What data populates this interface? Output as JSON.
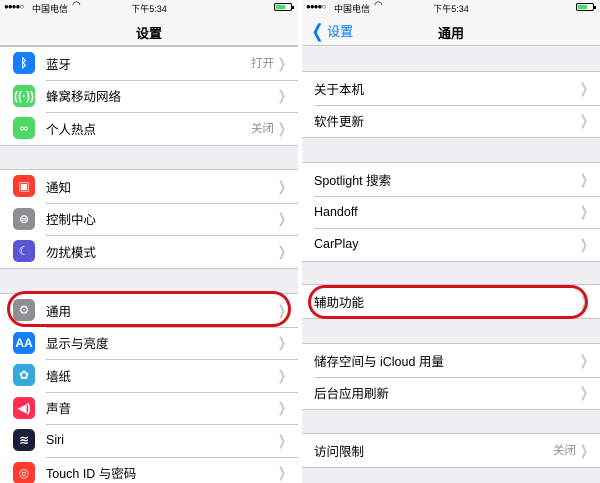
{
  "status_bar": {
    "signal": "●●●●○",
    "carrier": "中国电信",
    "time": "下午5:34"
  },
  "left": {
    "nav_title": "设置",
    "groups": [
      [
        {
          "label": "蓝牙",
          "value": "打开",
          "icon": "bluetooth-icon",
          "icon_glyph": "ᛒ",
          "color": "#147efb"
        },
        {
          "label": "蜂窝移动网络",
          "value": "",
          "icon": "cellular-icon",
          "icon_glyph": "((·))",
          "color": "#4cd964"
        },
        {
          "label": "个人热点",
          "value": "关闭",
          "icon": "hotspot-icon",
          "icon_glyph": "∞",
          "color": "#4cd964"
        }
      ],
      [
        {
          "label": "通知",
          "value": "",
          "icon": "notifications-icon",
          "icon_glyph": "▣",
          "color": "#ff3b30"
        },
        {
          "label": "控制中心",
          "value": "",
          "icon": "control-center-icon",
          "icon_glyph": "⊜",
          "color": "#8e8e93"
        },
        {
          "label": "勿扰模式",
          "value": "",
          "icon": "moon-icon",
          "icon_glyph": "☾",
          "color": "#5856d6"
        }
      ],
      [
        {
          "label": "通用",
          "value": "",
          "icon": "gear-icon",
          "icon_glyph": "⚙",
          "color": "#8e8e93"
        },
        {
          "label": "显示与亮度",
          "value": "",
          "icon": "display-icon",
          "icon_glyph": "AA",
          "color": "#147efb"
        },
        {
          "label": "墙纸",
          "value": "",
          "icon": "wallpaper-icon",
          "icon_glyph": "✿",
          "color": "#34aadc"
        },
        {
          "label": "声音",
          "value": "",
          "icon": "sound-icon",
          "icon_glyph": "◀)",
          "color": "#ff2d55"
        },
        {
          "label": "Siri",
          "value": "",
          "icon": "siri-icon",
          "icon_glyph": "≋",
          "color": "#1c1c3c"
        },
        {
          "label": "Touch ID 与密码",
          "value": "",
          "icon": "fingerprint-icon",
          "icon_glyph": "◎",
          "color": "#ff3b30"
        }
      ]
    ]
  },
  "right": {
    "nav_title": "通用",
    "back_label": "设置",
    "groups": [
      [
        {
          "label": "关于本机",
          "value": ""
        },
        {
          "label": "软件更新",
          "value": ""
        }
      ],
      [
        {
          "label": "Spotlight 搜索",
          "value": ""
        },
        {
          "label": "Handoff",
          "value": ""
        },
        {
          "label": "CarPlay",
          "value": ""
        }
      ],
      [
        {
          "label": "辅助功能",
          "value": ""
        }
      ],
      [
        {
          "label": "储存空间与 iCloud 用量",
          "value": ""
        },
        {
          "label": "后台应用刷新",
          "value": ""
        }
      ],
      [
        {
          "label": "访问限制",
          "value": "关闭"
        }
      ]
    ]
  },
  "colors": {
    "accent": "#007aff",
    "highlight": "#d4121b"
  }
}
